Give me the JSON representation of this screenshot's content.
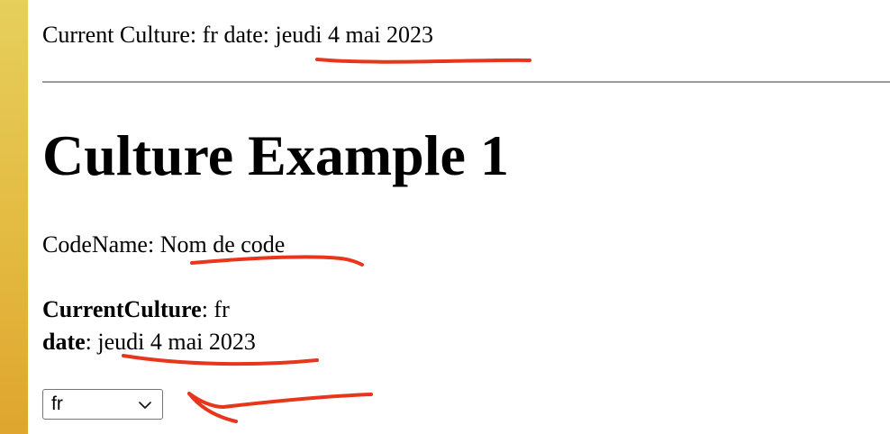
{
  "header": {
    "culture_label": "Current Culture: fr date: ",
    "culture_date": "jeudi 4 mai 2023"
  },
  "main": {
    "title": "Culture Example 1",
    "codename_label": "CodeName: ",
    "codename_value": "Nom de code",
    "current_culture_label": "CurrentCulture",
    "current_culture_value": ": fr",
    "date_label": "date",
    "date_value": ": jeudi 4 mai 2023"
  },
  "culture_select": {
    "selected": "fr"
  },
  "colors": {
    "annotation": "#e8361c",
    "side_strip": "#e3b83f",
    "divider": "#9a9a9a"
  },
  "icons": [
    "chevron-down-icon"
  ]
}
